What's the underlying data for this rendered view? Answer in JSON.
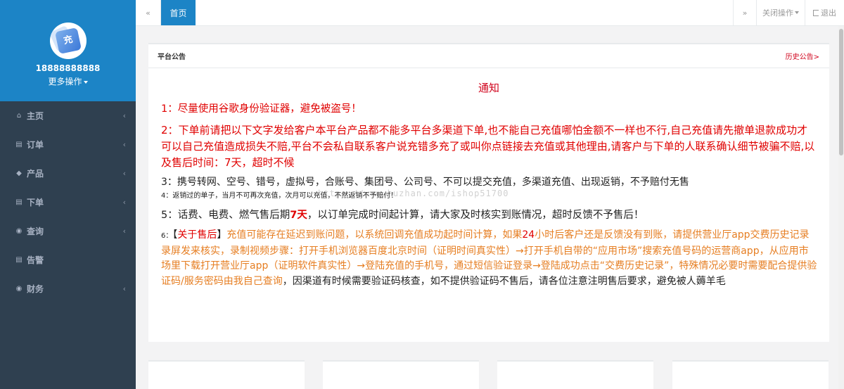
{
  "sidebar": {
    "phone": "18888888888",
    "more": "更多操作",
    "avatar_text": "充",
    "items": [
      {
        "icon": "home-icon",
        "glyph": "⌂",
        "label": "主页"
      },
      {
        "icon": "file-icon",
        "glyph": "▤",
        "label": "订单"
      },
      {
        "icon": "cube-icon",
        "glyph": "◆",
        "label": "产品"
      },
      {
        "icon": "file-icon",
        "glyph": "▤",
        "label": "下单"
      },
      {
        "icon": "globe-icon",
        "glyph": "◉",
        "label": "查询"
      },
      {
        "icon": "file-icon",
        "glyph": "▤",
        "label": "告警"
      },
      {
        "icon": "globe-icon",
        "glyph": "◉",
        "label": "财务"
      }
    ]
  },
  "topbar": {
    "prev_icon": "«",
    "home_tab": "首页",
    "next_icon": "»",
    "close_ops": "关闭操作",
    "exit": "退出"
  },
  "panel": {
    "title": "平台公告",
    "history_link": "历史公告>",
    "notice_title": "通知",
    "line1": "1：尽量使用谷歌身份验证器，避免被盗号！",
    "line2": "2：下单前请把以下文字发给客户本平台产品都不能多平台多渠道下单,也不能自己充值哪怕金额不一样也不行,自己充值请先撤单退款成功才可以自己充值造成损失不赔,平台不会私自联系客户说充错多充了或叫你点链接去充值或其他理由,请客户与下单的人联系确认细节被骗不赔,以及售后时间：7天，超时不候",
    "line3": "3：携号转网、空号、错号，虚拟号，合账号、集团号、公司号、不可以提交充值，多渠道充值、出现返销，不予赔付无售",
    "line4": "4：返销过的单子，当月不可再次充值，次月可以充值，不然返销不予赔付！",
    "line5_a": "5：话费、电费、燃气售后期",
    "line5_b": "7天",
    "line5_c": "，以订单完成时间起计算，请大家及时核实到账情况，超时反馈不予售后！",
    "line6_num": "6：",
    "line6_lb": "【",
    "line6_head": "关于售后",
    "line6_rb": "】",
    "line6_a": "充值可能存在延迟到账问题，以系统回调充值成功起时间计算，如果",
    "line6_b": "24",
    "line6_c": "小时后客户还是反馈没有到账，请提供营业厅app交费历史记录录屏发来核实，录制视频步骤：打开手机浏览器百度北京时间（证明时间真实性）→打开手机自带的“应用市场”搜索充值号码的运营商app，从应用市场里下载打开营业厅app（证明软件真实性）→登陆充值的手机号，通过短信验证登录→登陆成功点击“交费历史记录”，特殊情况必要时需要配合提供验证码/服务密码由我自己查询",
    "line6_d": "，因渠道有时候需要验证码核查，如不提供验证码不售后，请各位注意注明售后要求，避免被人薅羊毛",
    "watermark": "https://www.huzhan.com/ishop51700"
  }
}
